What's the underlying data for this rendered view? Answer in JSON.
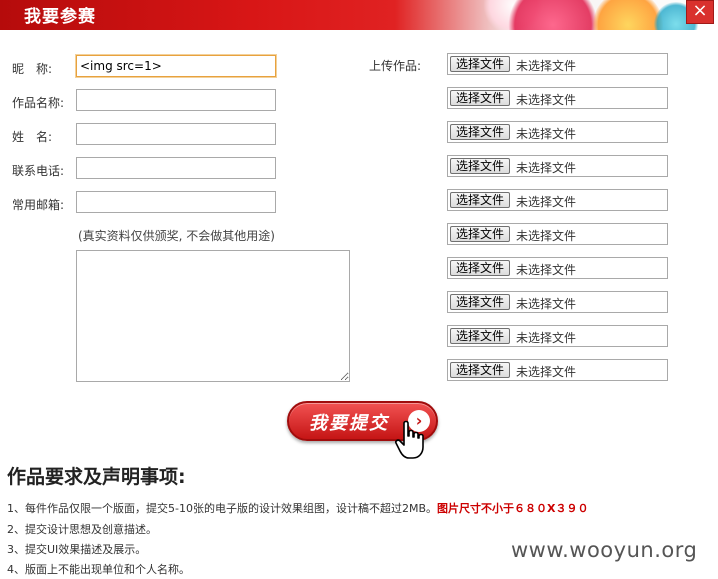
{
  "dialog": {
    "title": "我要参赛",
    "close_icon": "×"
  },
  "form": {
    "nickname": {
      "label": "昵　称:",
      "value": "<img src=1>"
    },
    "work_name": {
      "label": "作品名称:",
      "value": ""
    },
    "name": {
      "label": "姓　名:",
      "value": ""
    },
    "phone": {
      "label": "联系电话:",
      "value": ""
    },
    "email": {
      "label": "常用邮箱:",
      "value": ""
    },
    "note": "(真实资料仅供颁奖, 不会做其他用途)",
    "description": ""
  },
  "upload": {
    "label": "上传作品:",
    "button_label": "选择文件",
    "no_file_text": "未选择文件",
    "slots": [
      {
        "button": "选择文件",
        "status": "未选择文件"
      },
      {
        "button": "选择文件",
        "status": "未选择文件"
      },
      {
        "button": "选择文件",
        "status": "未选择文件"
      },
      {
        "button": "选择文件",
        "status": "未选择文件"
      },
      {
        "button": "选择文件",
        "status": "未选择文件"
      },
      {
        "button": "选择文件",
        "status": "未选择文件"
      },
      {
        "button": "选择文件",
        "status": "未选择文件"
      },
      {
        "button": "选择文件",
        "status": "未选择文件"
      },
      {
        "button": "选择文件",
        "status": "未选择文件"
      },
      {
        "button": "选择文件",
        "status": "未选择文件"
      }
    ]
  },
  "submit": {
    "label": "我要提交",
    "arrow_icon": "›"
  },
  "requirements": {
    "title": "作品要求及声明事项:",
    "items": [
      "1、每件作品仅限一个版面，提交5-10张的电子版的设计效果组图，设计稿不超过2MB。",
      "2、提交设计思想及创意描述。",
      "3、提交UI效果描述及展示。",
      "4、版面上不能出现单位和个人名称。"
    ],
    "item1_highlight": "图片尺寸不小于６８０Х３９０"
  },
  "watermark": "www.wooyun.org",
  "colors": {
    "header_red": "#d81616",
    "submit_red": "#c51515",
    "highlight": "#cc0000",
    "focus_border": "#e8a23e"
  }
}
